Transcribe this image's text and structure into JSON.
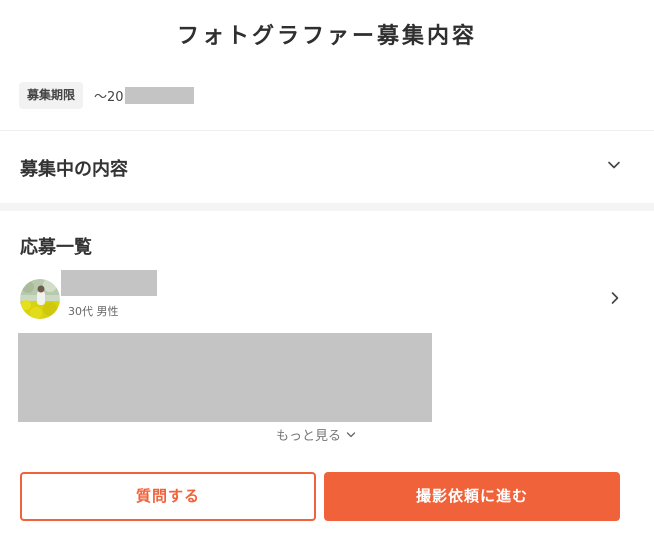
{
  "title": "フォトグラファー募集内容",
  "deadline": {
    "badge_label": "募集期限",
    "value_prefix": "～20"
  },
  "accordion": {
    "label": "募集中の内容",
    "icon": "chevron-down-icon"
  },
  "applicants": {
    "heading": "応募一覧",
    "items": [
      {
        "meta": "30代 男性",
        "avatar_icon": "user-avatar-photo"
      }
    ],
    "more_label": "もっと見る"
  },
  "actions": {
    "question_label": "質問する",
    "request_label": "撮影依頼に進む"
  },
  "colors": {
    "accent": "#f0623a",
    "redaction": "#c4c4c4"
  }
}
